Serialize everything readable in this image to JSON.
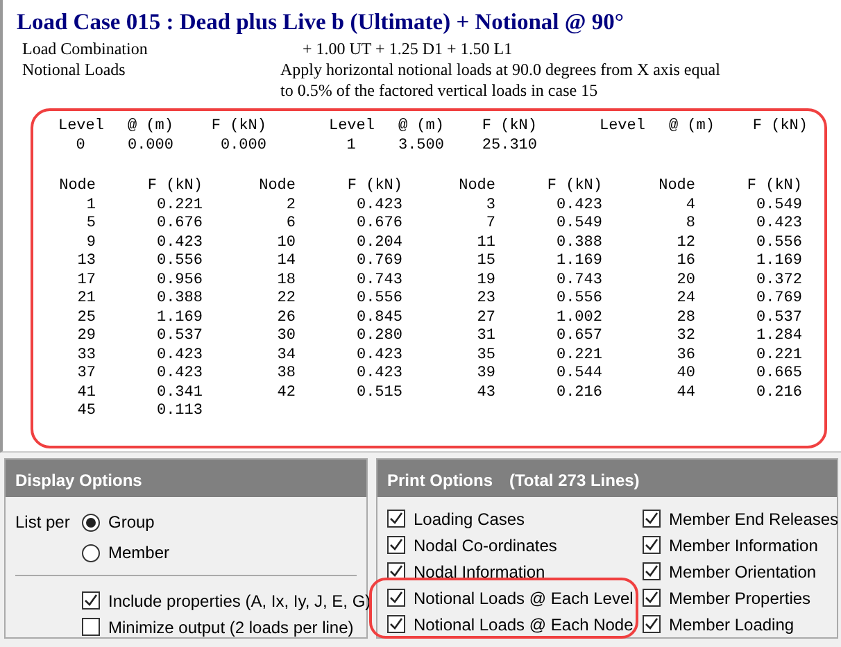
{
  "report": {
    "title": "Load Case 015 : Dead plus Live b (Ultimate) + Notional @ 90°",
    "rows": [
      {
        "label": "Load Combination",
        "lines": [
          "+ 1.00 UT + 1.25 D1 + 1.50 L1"
        ]
      },
      {
        "label": "Notional Loads",
        "lines": [
          "Apply horizontal notional loads at 90.0 degrees from X axis equal",
          "to 0.5% of the factored vertical loads in case 15"
        ]
      }
    ],
    "level_table": {
      "columns": [
        "Level",
        "@ (m)",
        "F (kN)",
        "Level",
        "@ (m)",
        "F (kN)",
        "Level",
        "@ (m)",
        "F (kN)"
      ],
      "rows": [
        [
          "0",
          "0.000",
          "0.000",
          "1",
          "3.500",
          "25.310"
        ]
      ]
    },
    "node_table": {
      "columns": [
        "Node",
        "F (kN)",
        "Node",
        "F (kN)",
        "Node",
        "F (kN)",
        "Node",
        "F (kN)"
      ],
      "rows": [
        [
          "1",
          "0.221",
          "2",
          "0.423",
          "3",
          "0.423",
          "4",
          "0.549"
        ],
        [
          "5",
          "0.676",
          "6",
          "0.676",
          "7",
          "0.549",
          "8",
          "0.423"
        ],
        [
          "9",
          "0.423",
          "10",
          "0.204",
          "11",
          "0.388",
          "12",
          "0.556"
        ],
        [
          "13",
          "0.556",
          "14",
          "0.769",
          "15",
          "1.169",
          "16",
          "1.169"
        ],
        [
          "17",
          "0.956",
          "18",
          "0.743",
          "19",
          "0.743",
          "20",
          "0.372"
        ],
        [
          "21",
          "0.388",
          "22",
          "0.556",
          "23",
          "0.556",
          "24",
          "0.769"
        ],
        [
          "25",
          "1.169",
          "26",
          "0.845",
          "27",
          "1.002",
          "28",
          "0.537"
        ],
        [
          "29",
          "0.537",
          "30",
          "0.280",
          "31",
          "0.657",
          "32",
          "1.284"
        ],
        [
          "33",
          "0.423",
          "34",
          "0.423",
          "35",
          "0.221",
          "36",
          "0.221"
        ],
        [
          "37",
          "0.423",
          "38",
          "0.423",
          "39",
          "0.544",
          "40",
          "0.665"
        ],
        [
          "41",
          "0.341",
          "42",
          "0.515",
          "43",
          "0.216",
          "44",
          "0.216"
        ],
        [
          "45",
          "0.113"
        ]
      ]
    }
  },
  "display_options": {
    "title": "Display Options",
    "list_per_label": "List per",
    "radios": [
      {
        "label": "Group",
        "selected": true
      },
      {
        "label": "Member",
        "selected": false
      }
    ],
    "checkboxes": [
      {
        "label": "Include properties (A, Ix, Iy, J, E, G)",
        "checked": true
      },
      {
        "label": "Minimize output (2 loads per line)",
        "checked": false
      }
    ]
  },
  "print_options": {
    "title": "Print Options",
    "total": "(Total 273 Lines)",
    "columns": [
      [
        {
          "label": "Loading Cases",
          "checked": true
        },
        {
          "label": "Nodal Co-ordinates",
          "checked": true
        },
        {
          "label": "Nodal Information",
          "checked": true
        },
        {
          "label": "Notional Loads @ Each Level",
          "checked": true
        },
        {
          "label": "Notional Loads @ Each Node",
          "checked": true
        }
      ],
      [
        {
          "label": "Member End Releases",
          "checked": true
        },
        {
          "label": "Member Information",
          "checked": true
        },
        {
          "label": "Member Orientation",
          "checked": true
        },
        {
          "label": "Member Properties",
          "checked": true
        },
        {
          "label": "Member Loading",
          "checked": true
        }
      ]
    ]
  }
}
